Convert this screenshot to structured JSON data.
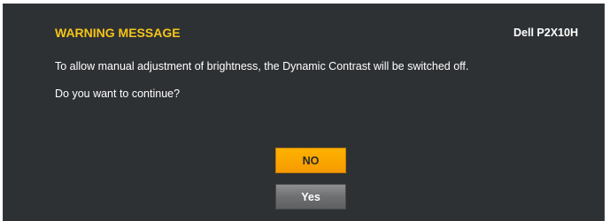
{
  "dialog": {
    "title": "WARNING MESSAGE",
    "model": "Dell P2X10H",
    "message_line1": "To allow manual adjustment of brightness, the Dynamic Contrast will be switched off.",
    "message_line2": "Do you want to continue?"
  },
  "buttons": {
    "no_label": "NO",
    "yes_label": "Yes"
  },
  "colors": {
    "panel_background": "#2e3134",
    "title_color": "#f5c518",
    "no_button": "#ffb200",
    "yes_button": "#6f7072"
  }
}
